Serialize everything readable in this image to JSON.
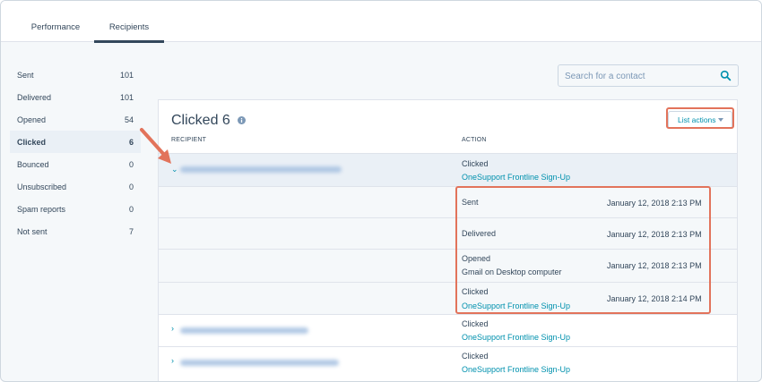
{
  "tabs": [
    {
      "label": "Performance"
    },
    {
      "label": "Recipients"
    }
  ],
  "stats": [
    {
      "label": "Sent",
      "value": "101"
    },
    {
      "label": "Delivered",
      "value": "101"
    },
    {
      "label": "Opened",
      "value": "54"
    },
    {
      "label": "Clicked",
      "value": "6"
    },
    {
      "label": "Bounced",
      "value": "0"
    },
    {
      "label": "Unsubscribed",
      "value": "0"
    },
    {
      "label": "Spam reports",
      "value": "0"
    },
    {
      "label": "Not sent",
      "value": "7"
    }
  ],
  "search": {
    "placeholder": "Search for a contact",
    "icon": "search-icon"
  },
  "card": {
    "title": "Clicked 6",
    "list_actions_label": "List actions",
    "col_recipient": "RECIPIENT",
    "col_action": "ACTION"
  },
  "rows": [
    {
      "action": "Clicked",
      "link": "OneSupport Frontline Sign-Up"
    },
    {
      "action": "Clicked",
      "link": "OneSupport Frontline Sign-Up"
    },
    {
      "action": "Clicked",
      "link": "OneSupport Frontline Sign-Up"
    }
  ],
  "events": [
    {
      "label": "Sent",
      "sub": "",
      "date": "January 12, 2018 2:13 PM"
    },
    {
      "label": "Delivered",
      "sub": "",
      "date": "January 12, 2018 2:13 PM"
    },
    {
      "label": "Opened",
      "sub": "Gmail on Desktop computer",
      "date": "January 12, 2018 2:13 PM"
    },
    {
      "label": "Clicked",
      "sub": "OneSupport Frontline Sign-Up",
      "date": "January 12, 2018 2:14 PM"
    }
  ],
  "colors": {
    "accent": "#0091ae",
    "highlight": "#e2735b",
    "text": "#33475b"
  }
}
